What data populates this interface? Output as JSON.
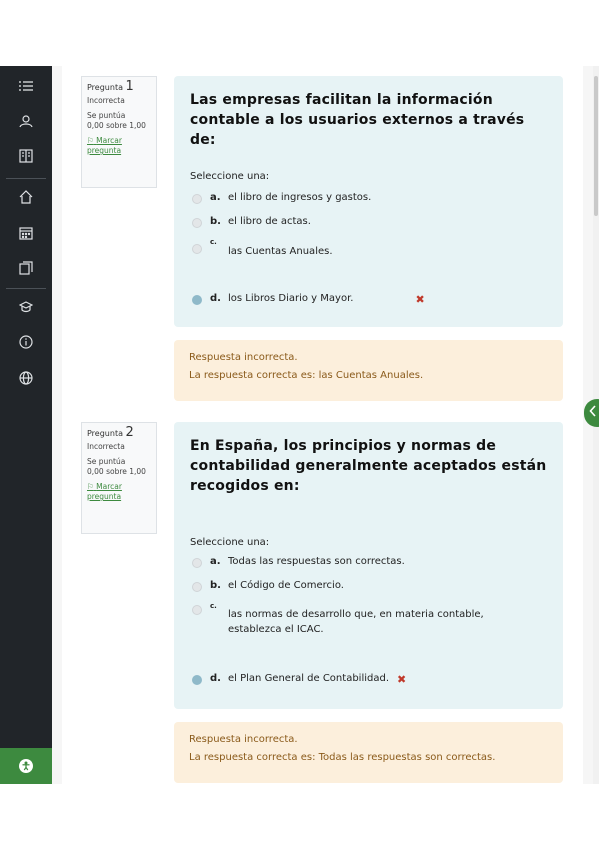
{
  "sidebar": {
    "icons": [
      "list-icon",
      "user-graduate-icon",
      "book-icon",
      "home-icon",
      "calendar-icon",
      "files-icon",
      "cap-icon",
      "info-icon",
      "globe-icon"
    ],
    "accessibility_icon": "accessibility-icon"
  },
  "questions": [
    {
      "info": {
        "label": "Pregunta",
        "number": "1",
        "state": "Incorrecta",
        "grade_1": "Se puntúa",
        "grade_2": "0,00 sobre 1,00",
        "flag": "Marcar pregunta"
      },
      "text": "Las empresas facilitan la información contable a los usuarios externos a través de:",
      "prompt": "Seleccione una:",
      "options": [
        {
          "letter": "a.",
          "text": "el libro de ingresos y gastos."
        },
        {
          "letter": "b.",
          "text": "el libro de actas."
        },
        {
          "letter": "c.",
          "text": "las Cuentas Anuales."
        },
        {
          "letter": "d.",
          "text": "los Libros Diario y Mayor.",
          "selected": true,
          "mark": "✖"
        }
      ],
      "feedback": {
        "line1": "Respuesta incorrecta.",
        "line2": "La respuesta correcta es: las Cuentas Anuales."
      }
    },
    {
      "info": {
        "label": "Pregunta",
        "number": "2",
        "state": "Incorrecta",
        "grade_1": "Se puntúa",
        "grade_2": "0,00 sobre 1,00",
        "flag": "Marcar pregunta"
      },
      "text": "En España, los principios y normas de contabilidad generalmente aceptados están recogidos en:",
      "prompt": "Seleccione una:",
      "options": [
        {
          "letter": "a.",
          "text": "Todas las respuestas son correctas."
        },
        {
          "letter": "b.",
          "text": "el Código de Comercio."
        },
        {
          "letter": "c.",
          "text": "las normas de desarrollo que, en materia contable, establezca el ICAC."
        },
        {
          "letter": "d.",
          "text": "el Plan General de Contabilidad.",
          "selected": true,
          "mark": "✖"
        }
      ],
      "feedback": {
        "line1": "Respuesta incorrecta.",
        "line2": "La respuesta correcta es: Todas las respuestas son correctas."
      }
    }
  ],
  "colors": {
    "sidebar": "#212529",
    "accent": "#3d8a3f",
    "question_bg": "#e7f3f5",
    "feedback_bg": "#fcefdc",
    "wrong": "#c0392b"
  }
}
